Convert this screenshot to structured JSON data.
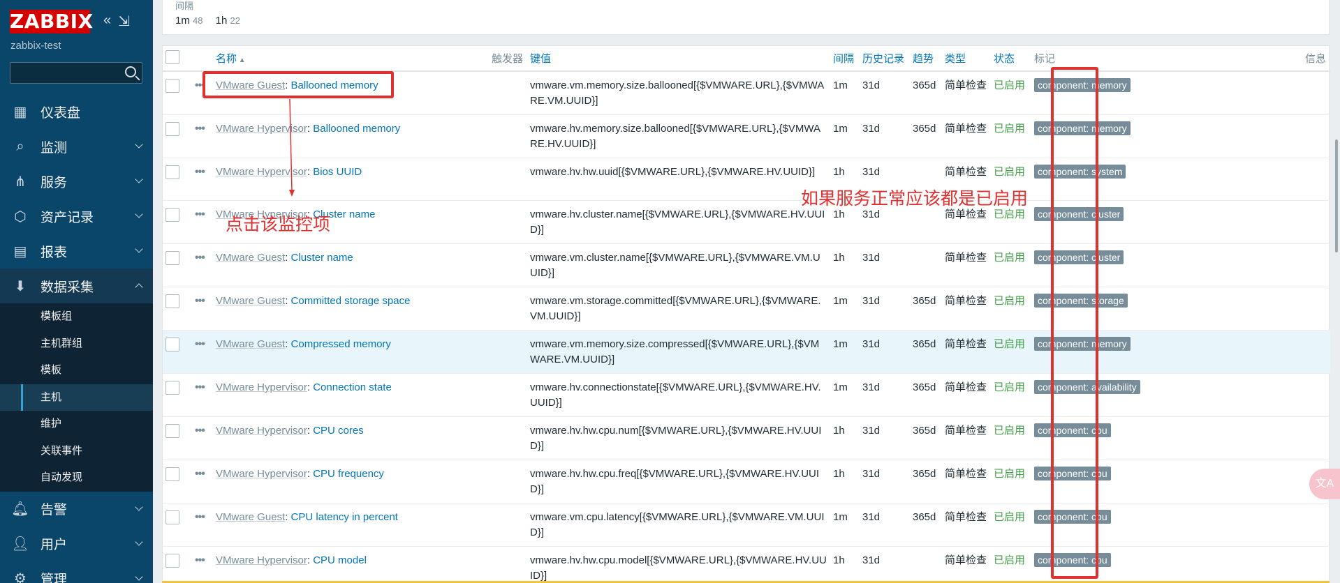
{
  "app": {
    "logo": "ZABBIX",
    "server_name": "zabbix-test",
    "collapse_icons": [
      "«",
      "⇲"
    ]
  },
  "search": {
    "placeholder": ""
  },
  "nav": [
    {
      "label": "仪表盘",
      "icon": "dashboard-icon",
      "glyph": "▦",
      "chevron": false
    },
    {
      "label": "监测",
      "icon": "monitoring-icon",
      "glyph": "⌕",
      "chevron": true
    },
    {
      "label": "服务",
      "icon": "services-icon",
      "glyph": "⋔",
      "chevron": true
    },
    {
      "label": "资产记录",
      "icon": "inventory-icon",
      "glyph": "⬡",
      "chevron": true
    },
    {
      "label": "报表",
      "icon": "reports-icon",
      "glyph": "▤",
      "chevron": true
    },
    {
      "label": "数据采集",
      "icon": "data-collection-icon",
      "glyph": "⬇",
      "chevron": true,
      "expanded": true
    }
  ],
  "subnav": [
    "模板组",
    "主机群组",
    "模板",
    "主机",
    "维护",
    "关联事件",
    "自动发现"
  ],
  "subnav_active": "主机",
  "nav_bottom": [
    {
      "label": "告警",
      "icon": "alerts-icon",
      "glyph": "🔔︎"
    },
    {
      "label": "用户",
      "icon": "users-icon",
      "glyph": "👤︎"
    },
    {
      "label": "管理",
      "icon": "administration-icon",
      "glyph": "⚙"
    }
  ],
  "interval": {
    "title": "间隔",
    "v1": "1m",
    "c1": "48",
    "v2": "1h",
    "c2": "22"
  },
  "table": {
    "headers": {
      "name": "名称",
      "triggers": "触发器",
      "key": "键值",
      "interval": "间隔",
      "history": "历史记录",
      "trends": "趋势",
      "type": "类型",
      "status": "状态",
      "tags": "标记",
      "info": "信息"
    },
    "rows": [
      {
        "prefix": "VMware Guest",
        "name": "Ballooned memory",
        "key": "vmware.vm.memory.size.ballooned[{$VMWARE.URL},{$VMWARE.VM.UUID}]",
        "interval": "1m",
        "history": "31d",
        "trends": "365d",
        "type": "简单检查",
        "status": "已启用",
        "tag": "component: memory"
      },
      {
        "prefix": "VMware Hypervisor",
        "name": "Ballooned memory",
        "key": "vmware.hv.memory.size.ballooned[{$VMWARE.URL},{$VMWARE.HV.UUID}]",
        "interval": "1m",
        "history": "31d",
        "trends": "365d",
        "type": "简单检查",
        "status": "已启用",
        "tag": "component: memory"
      },
      {
        "prefix": "VMware Hypervisor",
        "name": "Bios UUID",
        "key": "vmware.hv.hw.uuid[{$VMWARE.URL},{$VMWARE.HV.UUID}]",
        "interval": "1h",
        "history": "31d",
        "trends": "",
        "type": "简单检查",
        "status": "已启用",
        "tag": "component: system"
      },
      {
        "prefix": "VMware Hypervisor",
        "name": "Cluster name",
        "key": "vmware.hv.cluster.name[{$VMWARE.URL},{$VMWARE.HV.UUID}]",
        "interval": "1h",
        "history": "31d",
        "trends": "",
        "type": "简单检查",
        "status": "已启用",
        "tag": "component: cluster"
      },
      {
        "prefix": "VMware Guest",
        "name": "Cluster name",
        "key": "vmware.vm.cluster.name[{$VMWARE.URL},{$VMWARE.VM.UUID}]",
        "interval": "1h",
        "history": "31d",
        "trends": "",
        "type": "简单检查",
        "status": "已启用",
        "tag": "component: cluster"
      },
      {
        "prefix": "VMware Guest",
        "name": "Committed storage space",
        "key": "vmware.vm.storage.committed[{$VMWARE.URL},{$VMWARE.VM.UUID}]",
        "interval": "1m",
        "history": "31d",
        "trends": "365d",
        "type": "简单检查",
        "status": "已启用",
        "tag": "component: storage"
      },
      {
        "prefix": "VMware Guest",
        "name": "Compressed memory",
        "key": "vmware.vm.memory.size.compressed[{$VMWARE.URL},{$VMWARE.VM.UUID}]",
        "interval": "1m",
        "history": "31d",
        "trends": "365d",
        "type": "简单检查",
        "status": "已启用",
        "tag": "component: memory",
        "highlight": true
      },
      {
        "prefix": "VMware Hypervisor",
        "name": "Connection state",
        "key": "vmware.hv.connectionstate[{$VMWARE.URL},{$VMWARE.HV.UUID}]",
        "interval": "1m",
        "history": "31d",
        "trends": "365d",
        "type": "简单检查",
        "status": "已启用",
        "tag": "component: availability"
      },
      {
        "prefix": "VMware Hypervisor",
        "name": "CPU cores",
        "key": "vmware.hv.hw.cpu.num[{$VMWARE.URL},{$VMWARE.HV.UUID}]",
        "interval": "1h",
        "history": "31d",
        "trends": "365d",
        "type": "简单检查",
        "status": "已启用",
        "tag": "component: cpu"
      },
      {
        "prefix": "VMware Hypervisor",
        "name": "CPU frequency",
        "key": "vmware.hv.hw.cpu.freq[{$VMWARE.URL},{$VMWARE.HV.UUID}]",
        "interval": "1h",
        "history": "31d",
        "trends": "365d",
        "type": "简单检查",
        "status": "已启用",
        "tag": "component: cpu"
      },
      {
        "prefix": "VMware Guest",
        "name": "CPU latency in percent",
        "key": "vmware.vm.cpu.latency[{$VMWARE.URL},{$VMWARE.VM.UUID}]",
        "interval": "1m",
        "history": "31d",
        "trends": "365d",
        "type": "简单检查",
        "status": "已启用",
        "tag": "component: cpu"
      },
      {
        "prefix": "VMware Hypervisor",
        "name": "CPU model",
        "key": "vmware.hv.hw.cpu.model[{$VMWARE.URL},{$VMWARE.HV.UUID}]",
        "interval": "1h",
        "history": "31d",
        "trends": "",
        "type": "简单检查",
        "status": "已启用",
        "tag": "component: cpu"
      }
    ]
  },
  "annotations": {
    "click_hint": "点击该监控项",
    "status_hint": "如果服务正常应该都是已启用",
    "color": "#e03131"
  },
  "float_button": "文A"
}
